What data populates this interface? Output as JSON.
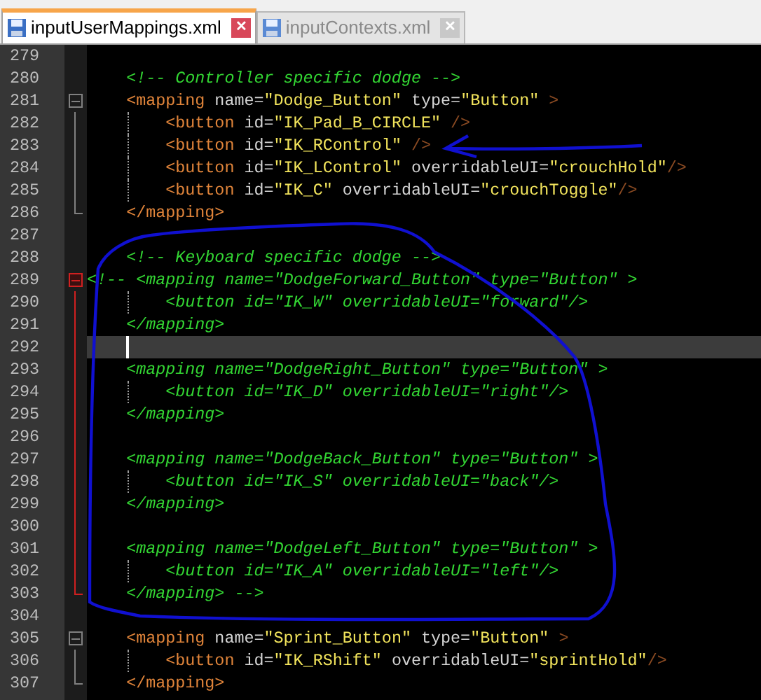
{
  "tabs": [
    {
      "label": "inputUserMappings.xml",
      "selected": true,
      "close": "✕"
    },
    {
      "label": "inputContexts.xml",
      "selected": false,
      "close": "✕"
    }
  ],
  "editor": {
    "lines": [
      {
        "number": "279",
        "current": false
      },
      {
        "number": "280",
        "current": false,
        "segments": [
          {
            "kind": "comment",
            "text": "    <!-- Controller specific dodge -->"
          }
        ]
      },
      {
        "number": "281",
        "fold": {
          "kind": "start",
          "highlighted": false
        },
        "current": false,
        "segments": [
          {
            "kind": "tag",
            "text": "    <mapping"
          },
          {
            "kind": "attr",
            "text": " name="
          },
          {
            "kind": "value",
            "text": "\"Dodge_Button\""
          },
          {
            "kind": "attr",
            "text": " type="
          },
          {
            "kind": "value",
            "text": "\"Button\""
          },
          {
            "kind": "punct",
            "text": " >"
          }
        ]
      },
      {
        "number": "282",
        "fold": {
          "kind": "mid",
          "highlighted": false
        },
        "current": false,
        "segments": [
          {
            "kind": "tag",
            "text": "        <button"
          },
          {
            "kind": "attr",
            "text": " id="
          },
          {
            "kind": "value",
            "text": "\"IK_Pad_B_CIRCLE\""
          },
          {
            "kind": "punct",
            "text": " />"
          }
        ]
      },
      {
        "number": "283",
        "fold": {
          "kind": "mid",
          "highlighted": false
        },
        "current": false,
        "segments": [
          {
            "kind": "tag",
            "text": "        <button"
          },
          {
            "kind": "attr",
            "text": " id="
          },
          {
            "kind": "value",
            "text": "\"IK_RControl\""
          },
          {
            "kind": "punct",
            "text": " />"
          }
        ]
      },
      {
        "number": "284",
        "fold": {
          "kind": "mid",
          "highlighted": false
        },
        "current": false,
        "segments": [
          {
            "kind": "tag",
            "text": "        <button"
          },
          {
            "kind": "attr",
            "text": " id="
          },
          {
            "kind": "value",
            "text": "\"IK_LControl\""
          },
          {
            "kind": "attr",
            "text": " overridableUI="
          },
          {
            "kind": "value",
            "text": "\"crouchHold\""
          },
          {
            "kind": "punct",
            "text": "/>"
          }
        ]
      },
      {
        "number": "285",
        "fold": {
          "kind": "mid",
          "highlighted": false
        },
        "current": false,
        "segments": [
          {
            "kind": "tag",
            "text": "        <button"
          },
          {
            "kind": "attr",
            "text": " id="
          },
          {
            "kind": "value",
            "text": "\"IK_C\""
          },
          {
            "kind": "attr",
            "text": " overridableUI="
          },
          {
            "kind": "value",
            "text": "\"crouchToggle\""
          },
          {
            "kind": "punct",
            "text": "/>"
          }
        ]
      },
      {
        "number": "286",
        "fold": {
          "kind": "end",
          "highlighted": false
        },
        "current": false,
        "segments": [
          {
            "kind": "tag",
            "text": "    </mapping>"
          }
        ]
      },
      {
        "number": "287",
        "current": false
      },
      {
        "number": "288",
        "current": false,
        "segments": [
          {
            "kind": "comment",
            "text": "    <!-- Keyboard specific dodge -->"
          }
        ]
      },
      {
        "number": "289",
        "fold": {
          "kind": "start",
          "highlighted": true
        },
        "current": false,
        "segments": [
          {
            "kind": "comment",
            "text": "<!-- <mapping name=\"DodgeForward_Button\" type=\"Button\" >"
          }
        ]
      },
      {
        "number": "290",
        "fold": {
          "kind": "mid",
          "highlighted": true
        },
        "current": false,
        "segments": [
          {
            "kind": "comment",
            "text": "        <button id=\"IK_W\" overridableUI=\"forward\"/>"
          }
        ]
      },
      {
        "number": "291",
        "fold": {
          "kind": "mid",
          "highlighted": true
        },
        "current": false,
        "segments": [
          {
            "kind": "comment",
            "text": "    </mapping>"
          }
        ]
      },
      {
        "number": "292",
        "fold": {
          "kind": "mid",
          "highlighted": true
        },
        "current": true
      },
      {
        "number": "293",
        "fold": {
          "kind": "mid",
          "highlighted": true
        },
        "current": false,
        "segments": [
          {
            "kind": "comment",
            "text": "    <mapping name=\"DodgeRight_Button\" type=\"Button\" >"
          }
        ]
      },
      {
        "number": "294",
        "fold": {
          "kind": "mid",
          "highlighted": true
        },
        "current": false,
        "segments": [
          {
            "kind": "comment",
            "text": "        <button id=\"IK_D\" overridableUI=\"right\"/>"
          }
        ]
      },
      {
        "number": "295",
        "fold": {
          "kind": "mid",
          "highlighted": true
        },
        "current": false,
        "segments": [
          {
            "kind": "comment",
            "text": "    </mapping>"
          }
        ]
      },
      {
        "number": "296",
        "fold": {
          "kind": "mid",
          "highlighted": true
        },
        "current": false
      },
      {
        "number": "297",
        "fold": {
          "kind": "mid",
          "highlighted": true
        },
        "current": false,
        "segments": [
          {
            "kind": "comment",
            "text": "    <mapping name=\"DodgeBack_Button\" type=\"Button\" >"
          }
        ]
      },
      {
        "number": "298",
        "fold": {
          "kind": "mid",
          "highlighted": true
        },
        "current": false,
        "segments": [
          {
            "kind": "comment",
            "text": "        <button id=\"IK_S\" overridableUI=\"back\"/>"
          }
        ]
      },
      {
        "number": "299",
        "fold": {
          "kind": "mid",
          "highlighted": true
        },
        "current": false,
        "segments": [
          {
            "kind": "comment",
            "text": "    </mapping>"
          }
        ]
      },
      {
        "number": "300",
        "fold": {
          "kind": "mid",
          "highlighted": true
        },
        "current": false
      },
      {
        "number": "301",
        "fold": {
          "kind": "mid",
          "highlighted": true
        },
        "current": false,
        "segments": [
          {
            "kind": "comment",
            "text": "    <mapping name=\"DodgeLeft_Button\" type=\"Button\" >"
          }
        ]
      },
      {
        "number": "302",
        "fold": {
          "kind": "mid",
          "highlighted": true
        },
        "current": false,
        "segments": [
          {
            "kind": "comment",
            "text": "        <button id=\"IK_A\" overridableUI=\"left\"/>"
          }
        ]
      },
      {
        "number": "303",
        "fold": {
          "kind": "end",
          "highlighted": true
        },
        "current": false,
        "segments": [
          {
            "kind": "comment",
            "text": "    </mapping> -->"
          }
        ]
      },
      {
        "number": "304",
        "current": false
      },
      {
        "number": "305",
        "fold": {
          "kind": "start",
          "highlighted": false
        },
        "current": false,
        "segments": [
          {
            "kind": "tag",
            "text": "    <mapping"
          },
          {
            "kind": "attr",
            "text": " name="
          },
          {
            "kind": "value",
            "text": "\"Sprint_Button\""
          },
          {
            "kind": "attr",
            "text": " type="
          },
          {
            "kind": "value",
            "text": "\"Button\""
          },
          {
            "kind": "punct",
            "text": " >"
          }
        ]
      },
      {
        "number": "306",
        "fold": {
          "kind": "mid",
          "highlighted": false
        },
        "current": false,
        "segments": [
          {
            "kind": "tag",
            "text": "        <button"
          },
          {
            "kind": "attr",
            "text": " id="
          },
          {
            "kind": "value",
            "text": "\"IK_RShift\""
          },
          {
            "kind": "attr",
            "text": " overridableUI="
          },
          {
            "kind": "value",
            "text": "\"sprintHold\""
          },
          {
            "kind": "punct",
            "text": "/>"
          }
        ]
      },
      {
        "number": "307",
        "fold": {
          "kind": "end",
          "highlighted": false
        },
        "current": false,
        "segments": [
          {
            "kind": "tag",
            "text": "    </mapping>"
          }
        ]
      }
    ]
  }
}
